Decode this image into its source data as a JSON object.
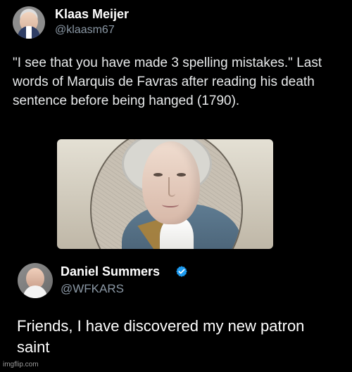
{
  "tweet1": {
    "author_name": "Klaas Meijer",
    "handle": "@klaasm67",
    "text": "\"I see that you have made 3 spelling mistakes.\" Last words of Marquis de Favras after reading his death sentence before being hanged (1790)."
  },
  "tweet2": {
    "author_name": "Daniel Summers",
    "handle": "@WFKARS",
    "text": "Friends, I have discovered my new patron saint"
  },
  "watermark": {
    "text": "imgflip.com"
  },
  "icons": {
    "verified": "verified-badge-icon"
  },
  "colors": {
    "background": "#000000",
    "text_primary": "#e7e9ea",
    "text_secondary": "#8b98a5",
    "verified_blue": "#1d9bf0"
  }
}
